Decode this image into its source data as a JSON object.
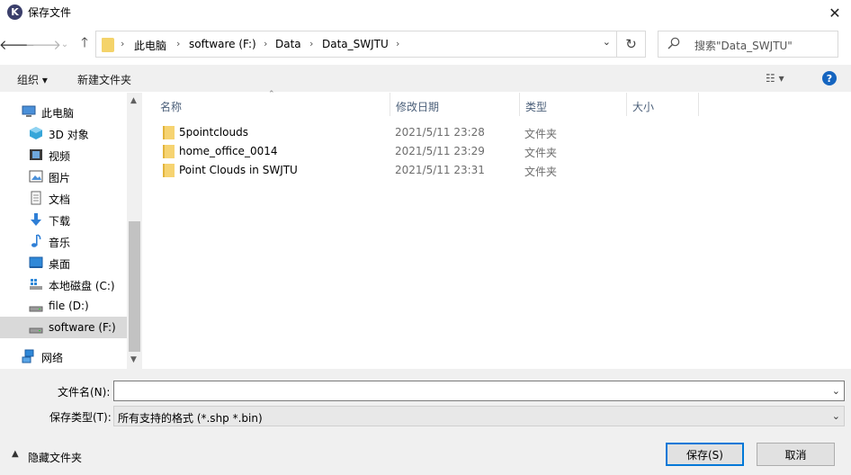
{
  "window": {
    "title": "保存文件",
    "app_icon_letter": "K",
    "close_glyph": "✕"
  },
  "address": {
    "crumbs": [
      "此电脑",
      "software (F:)",
      "Data",
      "Data_SWJTU"
    ],
    "separator": "›"
  },
  "search": {
    "placeholder": "搜索\"Data_SWJTU\""
  },
  "toolbar": {
    "organize": "组织 ▾",
    "new_folder": "新建文件夹",
    "view_glyph": "☷ ▾",
    "help": "?"
  },
  "nav": {
    "items": [
      {
        "label": "此电脑",
        "icon": "computer-icon"
      },
      {
        "label": "3D 对象",
        "icon": "cube-icon"
      },
      {
        "label": "视频",
        "icon": "video-icon"
      },
      {
        "label": "图片",
        "icon": "picture-icon"
      },
      {
        "label": "文档",
        "icon": "document-icon"
      },
      {
        "label": "下载",
        "icon": "download-icon"
      },
      {
        "label": "音乐",
        "icon": "music-icon"
      },
      {
        "label": "桌面",
        "icon": "desktop-icon"
      },
      {
        "label": "本地磁盘 (C:)",
        "icon": "drive-c-icon"
      },
      {
        "label": "file (D:)",
        "icon": "drive-icon"
      },
      {
        "label": "software (F:)",
        "icon": "drive-icon",
        "selected": true
      },
      {
        "label": "网络",
        "icon": "network-icon"
      }
    ]
  },
  "columns": [
    "名称",
    "修改日期",
    "类型",
    "大小"
  ],
  "files": [
    {
      "name": "5pointclouds",
      "modified": "2021/5/11 23:28",
      "type": "文件夹"
    },
    {
      "name": "home_office_0014",
      "modified": "2021/5/11 23:29",
      "type": "文件夹"
    },
    {
      "name": "Point Clouds in SWJTU",
      "modified": "2021/5/11 23:31",
      "type": "文件夹"
    }
  ],
  "form": {
    "filename_label": "文件名(N):",
    "filename_value": "",
    "filetype_label": "保存类型(T):",
    "filetype_value": "所有支持的格式 (*.shp *.bin)"
  },
  "footer": {
    "hide_folders": "隐藏文件夹",
    "save": "保存(S)",
    "cancel": "取消"
  }
}
